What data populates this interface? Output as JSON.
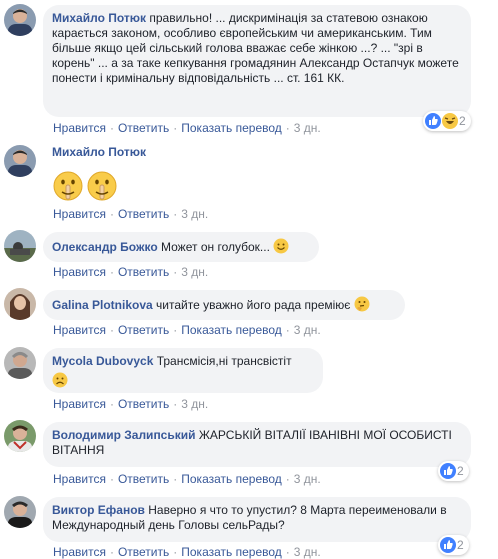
{
  "actions": {
    "like": "Нравится",
    "reply": "Ответить",
    "translate": "Показать перевод",
    "sep": "·"
  },
  "comments": [
    {
      "author": "Михайло Потюк",
      "text": "правильно! ... дискримінація за статевою ознакою карається законом, особливо європейським чи американським. Тим більше якщо цей сільський голова вважає себе жінкою ...? ... \"зрі в корень\" ... а за таке кепкування громадянин Александр Остапчук можете понести і кримінальну відповідальність ... ст. 161 КК.",
      "time": "3 дн.",
      "reactions_count": "2",
      "reaction_icons": [
        "like-icon",
        "haha-icon"
      ]
    },
    {
      "author": "Михайло Потюк",
      "text": "",
      "emoji": [
        "shushing-face-icon",
        "shushing-face-icon"
      ],
      "time": "3 дн."
    },
    {
      "author": "Олександр Божко",
      "text": "Может он голубок...",
      "emoji": [
        "slight-smile-icon"
      ],
      "time": "3 дн."
    },
    {
      "author": "Galina Plotnikova",
      "text": "читайте уважно його рада преміює",
      "emoji": [
        "thinking-face-icon"
      ],
      "time": "3 дн."
    },
    {
      "author": "Mycola Dubovyck",
      "text": "Трансмісія,ні трансвістіт",
      "emoji": [
        "frowning-face-icon"
      ],
      "time": "3 дн."
    },
    {
      "author": "Володимир Залипський",
      "text": "ЖАРСЬКІЙ ВІТАЛІЇ ІВАНІВНІ МОЇ ОСОБИСТІ ВІТАННЯ",
      "time": "3 дн.",
      "reactions_count": "2",
      "reaction_icons": [
        "like-icon"
      ]
    },
    {
      "author": "Виктор Ефанов",
      "text": "Наверно я что то упустил? 8 Марта переименовали в Международный день Головы сельРады?",
      "time": "3 дн.",
      "reactions_count": "2",
      "reaction_icons": [
        "like-icon"
      ]
    }
  ]
}
